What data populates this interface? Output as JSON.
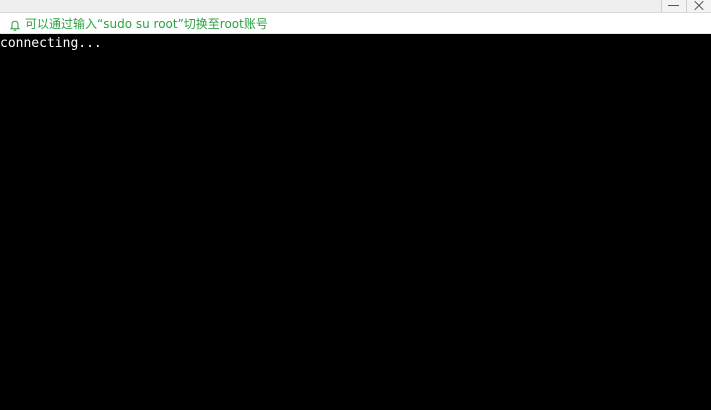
{
  "notice": {
    "icon": "bell-icon",
    "text": "可以通过输入“sudo su root”切换至root账号",
    "color": "#2ea043"
  },
  "window_controls": {
    "minimize_icon": "minimize-icon",
    "close_icon": "close-icon"
  },
  "terminal": {
    "background": "#000000",
    "text_color": "#ffffff",
    "lines": [
      "connecting..."
    ]
  }
}
